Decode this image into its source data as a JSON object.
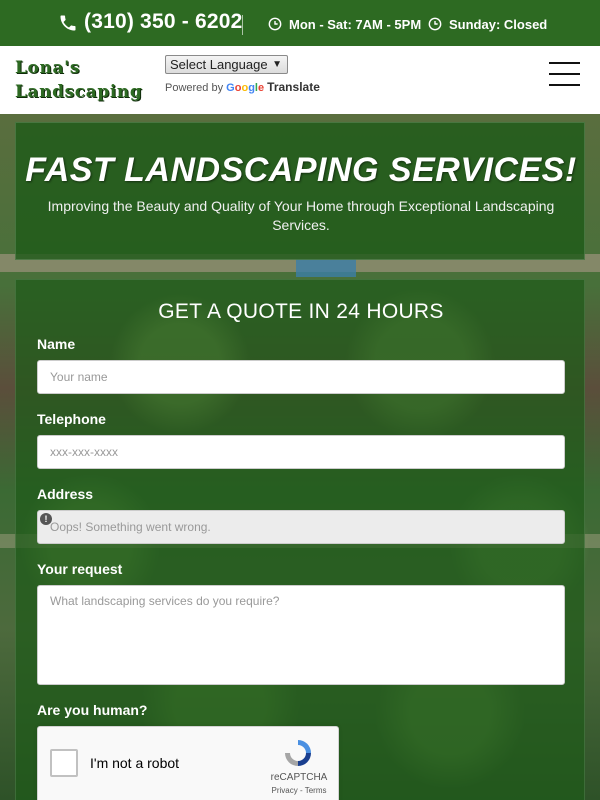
{
  "topbar": {
    "phone": "(310) 350 - 6202",
    "hours_weekday": "Mon - Sat: 7AM - 5PM",
    "hours_sunday": "Sunday: Closed"
  },
  "header": {
    "logo_line1": "Lona's",
    "logo_line2": "Landscaping",
    "language_select": "Select Language",
    "powered_by": "Powered by",
    "google": "Google",
    "translate": "Translate"
  },
  "banner": {
    "title": "FAST LANDSCAPING SERVICES!",
    "subtitle": "Improving the Beauty and Quality of Your Home through Exceptional Landscaping Services."
  },
  "form": {
    "heading": "GET A QUOTE IN 24 HOURS",
    "name_label": "Name",
    "name_placeholder": "Your name",
    "telephone_label": "Telephone",
    "telephone_placeholder": "xxx-xxx-xxxx",
    "address_label": "Address",
    "address_placeholder": "Oops! Something went wrong.",
    "request_label": "Your request",
    "request_placeholder": "What landscaping services do you require?",
    "human_label": "Are you human?"
  },
  "captcha": {
    "label": "I'm not a robot",
    "brand": "reCAPTCHA",
    "links": "Privacy - Terms"
  },
  "colors": {
    "brand_green": "#2d6a22",
    "panel_green": "#1e5a19"
  }
}
